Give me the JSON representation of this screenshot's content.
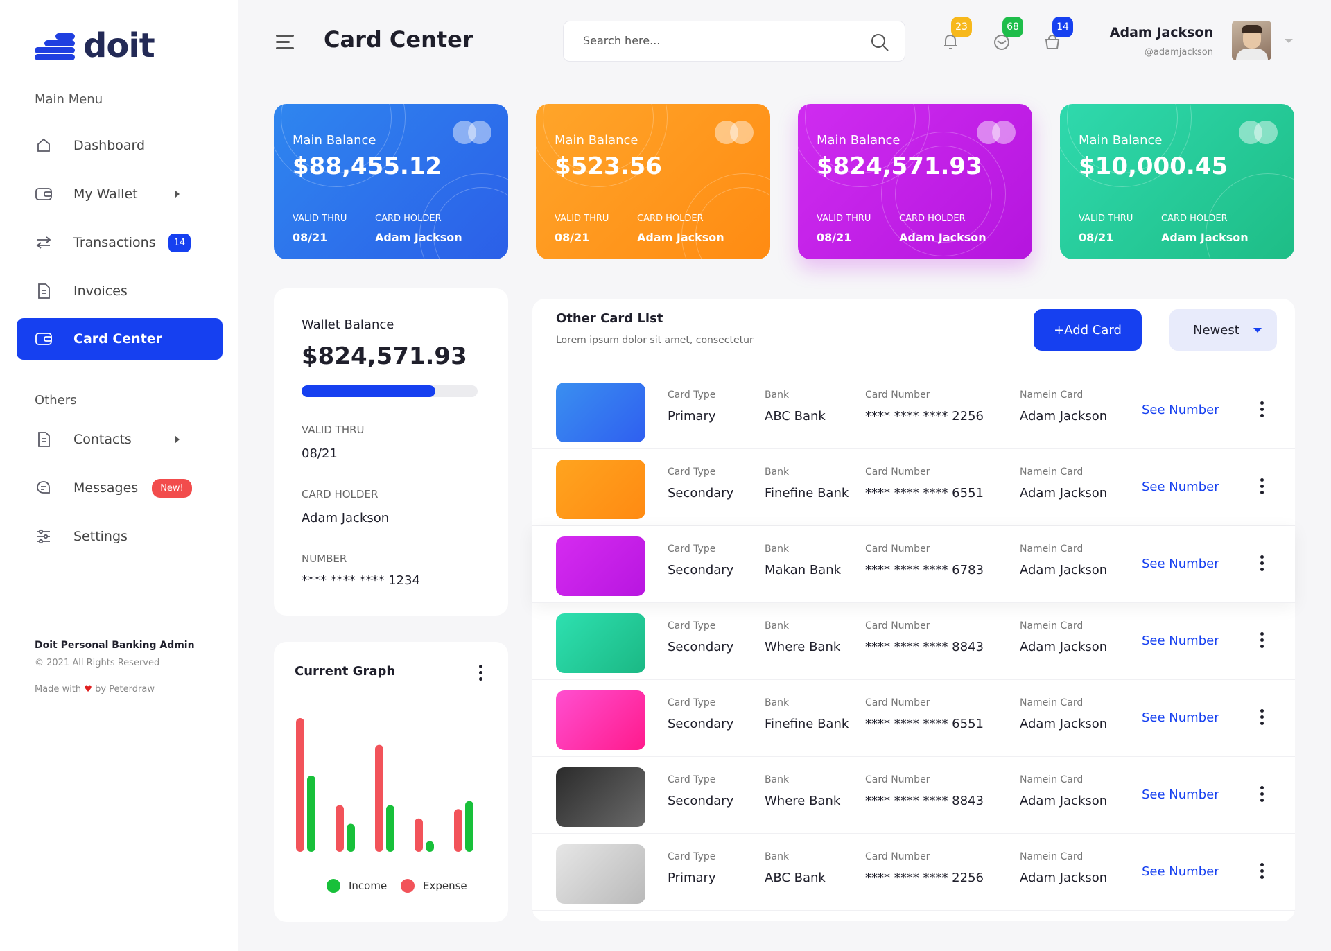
{
  "app": {
    "logo_text": "doit",
    "page_title": "Card Center"
  },
  "sidebar": {
    "main_menu_label": "Main Menu",
    "others_label": "Others",
    "items": [
      {
        "label": "Dashboard",
        "icon": "home-icon"
      },
      {
        "label": "My Wallet",
        "icon": "wallet-icon"
      },
      {
        "label": "Transactions",
        "icon": "transfer-icon",
        "badge": "14"
      },
      {
        "label": "Invoices",
        "icon": "document-icon"
      },
      {
        "label": "Card Center",
        "icon": "card-icon"
      },
      {
        "label": "Contacts",
        "icon": "contacts-icon"
      },
      {
        "label": "Messages",
        "icon": "message-icon",
        "badge": "New!"
      },
      {
        "label": "Settings",
        "icon": "settings-sliders-icon"
      }
    ],
    "footer": {
      "title": "Doit Personal Banking Admin",
      "copyright": "© 2021 All Rights Reserved",
      "made_prefix": "Made with",
      "made_suffix": "by Peterdraw"
    }
  },
  "header": {
    "search_placeholder": "Search here...",
    "notifications": {
      "bell": "23",
      "mail": "68",
      "bag": "14"
    },
    "user_name": "Adam Jackson",
    "user_handle": "@adamjackson"
  },
  "balance_cards": [
    {
      "label": "Main Balance",
      "value": "$88,455.12",
      "valid_thru_label": "VALID THRU",
      "valid_thru": "08/21",
      "holder_label": "CARD HOLDER",
      "holder": "Adam Jackson",
      "color": "#2f6df0"
    },
    {
      "label": "Main Balance",
      "value": "$523.56",
      "valid_thru_label": "VALID THRU",
      "valid_thru": "08/21",
      "holder_label": "CARD HOLDER",
      "holder": "Adam Jackson",
      "color": "#ff9a17"
    },
    {
      "label": "Main Balance",
      "value": "$824,571.93",
      "valid_thru_label": "VALID THRU",
      "valid_thru": "08/21",
      "holder_label": "CARD HOLDER",
      "holder": "Adam Jackson",
      "color": "#c31ee8"
    },
    {
      "label": "Main Balance",
      "value": "$10,000.45",
      "valid_thru_label": "VALID THRU",
      "valid_thru": "08/21",
      "holder_label": "CARD HOLDER",
      "holder": "Adam Jackson",
      "color": "#22cc96"
    }
  ],
  "wallet": {
    "title": "Wallet Balance",
    "value": "$824,571.93",
    "progress": 0.76,
    "valid_thru_label": "VALID THRU",
    "valid_thru": "08/21",
    "holder_label": "CARD HOLDER",
    "holder": "Adam Jackson",
    "number_label": "NUMBER",
    "number": "**** **** **** 1234"
  },
  "graph": {
    "title": "Current Graph",
    "legend_income": "Income",
    "legend_expense": "Expense",
    "income_color": "#18c03a",
    "expense_color": "#f2535a"
  },
  "chart_data": {
    "type": "bar",
    "series": [
      {
        "name": "Expense",
        "values": [
          100,
          35,
          80,
          25,
          32
        ]
      },
      {
        "name": "Income",
        "values": [
          57,
          21,
          35,
          8,
          38
        ]
      }
    ]
  },
  "card_list": {
    "title": "Other Card List",
    "subtitle": "Lorem ipsum dolor sit amet, consectetur",
    "add_button": "+Add Card",
    "sort_value": "Newest",
    "col_type": "Card Type",
    "col_bank": "Bank",
    "col_number": "Card Number",
    "col_name": "Namein Card",
    "see_label": "See Number",
    "rows": [
      {
        "type": "Primary",
        "bank": "ABC Bank",
        "number": "**** **** **** 2256",
        "name": "Adam Jackson",
        "c1": "#3a8ff0",
        "c2": "#2f5ff0"
      },
      {
        "type": "Secondary",
        "bank": "Finefine Bank",
        "number": "**** **** **** 6551",
        "name": "Adam Jackson",
        "c1": "#ffa41f",
        "c2": "#ff8a12"
      },
      {
        "type": "Secondary",
        "bank": "Makan Bank",
        "number": "**** **** **** 6783",
        "name": "Adam Jackson",
        "c1": "#d52bf0",
        "c2": "#b816e0"
      },
      {
        "type": "Secondary",
        "bank": "Where Bank",
        "number": "**** **** **** 8843",
        "name": "Adam Jackson",
        "c1": "#2ee0b0",
        "c2": "#1bb884"
      },
      {
        "type": "Secondary",
        "bank": "Finefine Bank",
        "number": "**** **** **** 6551",
        "name": "Adam Jackson",
        "c1": "#ff4fd0",
        "c2": "#ff1a8c"
      },
      {
        "type": "Secondary",
        "bank": "Where Bank",
        "number": "**** **** **** 8843",
        "name": "Adam Jackson",
        "c1": "#2b2b2b",
        "c2": "#6a6a6a"
      },
      {
        "type": "Primary",
        "bank": "ABC Bank",
        "number": "**** **** **** 2256",
        "name": "Adam Jackson",
        "c1": "#e6e6e6",
        "c2": "#b9b9b9"
      }
    ]
  }
}
